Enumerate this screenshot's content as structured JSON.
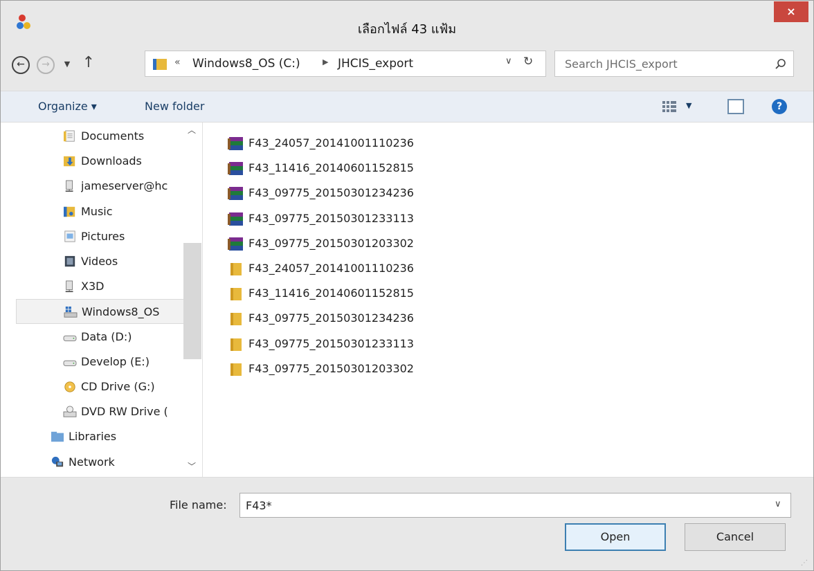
{
  "window": {
    "title": "เลือกไฟล์ 43 แฟ้ม",
    "close_label": "×"
  },
  "nav": {
    "back_label": "←",
    "forward_label": "→",
    "up_label": "↑",
    "address": {
      "prefix": "«",
      "segments": [
        "Windows8_OS (C:)",
        "JHCIS_export"
      ]
    },
    "search_placeholder": "Search JHCIS_export"
  },
  "toolbar": {
    "organize_label": "Organize ▾",
    "new_folder_label": "New folder"
  },
  "sidebar": {
    "items": [
      {
        "label": "Documents",
        "icon": "documents-icon",
        "indent": 1
      },
      {
        "label": "Downloads",
        "icon": "downloads-icon",
        "indent": 1
      },
      {
        "label": "jameserver@hc",
        "icon": "network-drive-icon",
        "indent": 1
      },
      {
        "label": "Music",
        "icon": "music-icon",
        "indent": 1
      },
      {
        "label": "Pictures",
        "icon": "pictures-icon",
        "indent": 1
      },
      {
        "label": "Videos",
        "icon": "videos-icon",
        "indent": 1
      },
      {
        "label": "X3D",
        "icon": "network-drive-icon",
        "indent": 1
      },
      {
        "label": "Windows8_OS",
        "icon": "system-drive-icon",
        "indent": 1,
        "selected": true
      },
      {
        "label": "Data (D:)",
        "icon": "drive-icon",
        "indent": 1
      },
      {
        "label": "Develop (E:)",
        "icon": "drive-icon",
        "indent": 1
      },
      {
        "label": "CD Drive (G:)",
        "icon": "cd-icon",
        "indent": 1
      },
      {
        "label": "DVD RW Drive (",
        "icon": "dvd-icon",
        "indent": 1
      },
      {
        "label": "Libraries",
        "icon": "libraries-icon",
        "indent": 0
      },
      {
        "label": "Network",
        "icon": "network-icon",
        "indent": 0
      }
    ]
  },
  "files": [
    {
      "name": "F43_24057_20141001110236",
      "type": "archive"
    },
    {
      "name": "F43_11416_20140601152815",
      "type": "archive"
    },
    {
      "name": "F43_09775_20150301234236",
      "type": "archive"
    },
    {
      "name": "F43_09775_20150301233113",
      "type": "archive"
    },
    {
      "name": "F43_09775_20150301203302",
      "type": "archive"
    },
    {
      "name": "F43_24057_20141001110236",
      "type": "folder"
    },
    {
      "name": "F43_11416_20140601152815",
      "type": "folder"
    },
    {
      "name": "F43_09775_20150301234236",
      "type": "folder"
    },
    {
      "name": "F43_09775_20150301233113",
      "type": "folder"
    },
    {
      "name": "F43_09775_20150301203302",
      "type": "folder"
    }
  ],
  "footer": {
    "file_name_label": "File name:",
    "file_name_value": "F43*",
    "open_label": "Open",
    "cancel_label": "Cancel"
  },
  "colors": {
    "close": "#c9473e",
    "toolbar_bg": "#e9eef5",
    "folder": "#e8b93c",
    "primary_border": "#3c7fb1"
  }
}
